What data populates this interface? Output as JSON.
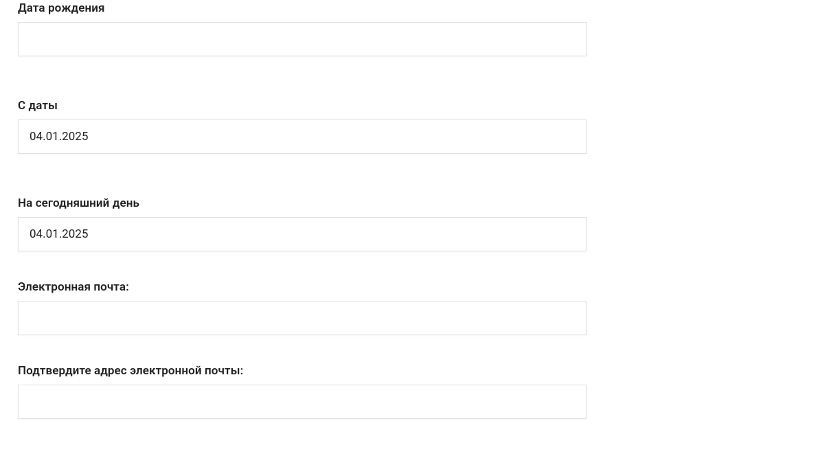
{
  "form": {
    "fields": {
      "birth_date": {
        "label": "Дата рождения",
        "value": ""
      },
      "from_date": {
        "label": "С даты",
        "value": "04.01.2025"
      },
      "today_date": {
        "label": "На сегодняшний день",
        "value": "04.01.2025"
      },
      "email": {
        "label": "Электронная почта:",
        "value": ""
      },
      "email_confirm": {
        "label": "Подтвердите адрес электронной почты:",
        "value": ""
      }
    }
  }
}
